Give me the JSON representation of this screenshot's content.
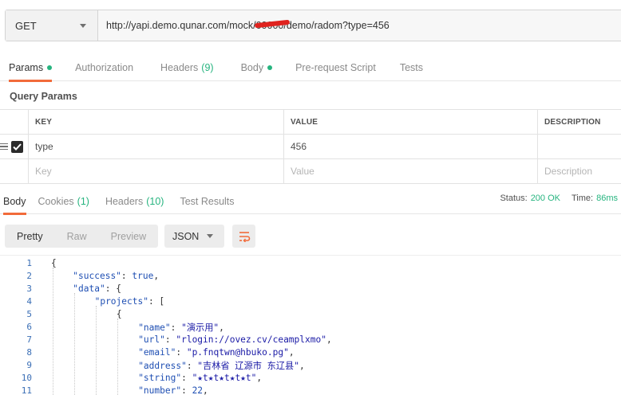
{
  "request": {
    "method": "GET",
    "url": "http://yapi.demo.qunar.com/mock/00000/demo/radom?type=456"
  },
  "request_tabs": [
    {
      "label": "Params",
      "active": true,
      "dot": true
    },
    {
      "label": "Authorization"
    },
    {
      "label": "Headers",
      "count": "(9)"
    },
    {
      "label": "Body",
      "dot": true
    },
    {
      "label": "Pre-request Script"
    },
    {
      "label": "Tests"
    }
  ],
  "query_params": {
    "title": "Query Params",
    "columns": [
      "KEY",
      "VALUE",
      "DESCRIPTION"
    ],
    "rows": [
      {
        "key": "type",
        "value": "456",
        "description": "",
        "checked": true
      }
    ],
    "placeholders": {
      "key": "Key",
      "value": "Value",
      "description": "Description"
    }
  },
  "response_tabs": [
    {
      "label": "Body",
      "active": true
    },
    {
      "label": "Cookies",
      "count": "(1)"
    },
    {
      "label": "Headers",
      "count": "(10)"
    },
    {
      "label": "Test Results"
    }
  ],
  "status": {
    "status_label": "Status:",
    "status_value": "200 OK",
    "time_label": "Time:",
    "time_value": "86ms"
  },
  "view_modes": [
    "Pretty",
    "Raw",
    "Preview"
  ],
  "format": "JSON",
  "code_lines": [
    {
      "n": "1",
      "indent": 0,
      "parts": [
        [
          "p",
          "{"
        ]
      ]
    },
    {
      "n": "2",
      "indent": 1,
      "parts": [
        [
          "k",
          "\"success\""
        ],
        [
          "p",
          ": "
        ],
        [
          "b",
          "true"
        ],
        [
          "p",
          ","
        ]
      ]
    },
    {
      "n": "3",
      "indent": 1,
      "parts": [
        [
          "k",
          "\"data\""
        ],
        [
          "p",
          ": {"
        ]
      ]
    },
    {
      "n": "4",
      "indent": 2,
      "parts": [
        [
          "k",
          "\"projects\""
        ],
        [
          "p",
          ": ["
        ]
      ]
    },
    {
      "n": "5",
      "indent": 3,
      "parts": [
        [
          "p",
          "{"
        ]
      ]
    },
    {
      "n": "6",
      "indent": 4,
      "parts": [
        [
          "k",
          "\"name\""
        ],
        [
          "p",
          ": "
        ],
        [
          "s",
          "\"演示用\""
        ],
        [
          "p",
          ","
        ]
      ]
    },
    {
      "n": "7",
      "indent": 4,
      "parts": [
        [
          "k",
          "\"url\""
        ],
        [
          "p",
          ": "
        ],
        [
          "s",
          "\"rlogin://ovez.cv/ceamplxmo\""
        ],
        [
          "p",
          ","
        ]
      ]
    },
    {
      "n": "8",
      "indent": 4,
      "parts": [
        [
          "k",
          "\"email\""
        ],
        [
          "p",
          ": "
        ],
        [
          "s",
          "\"p.fnqtwn@hbuko.pg\""
        ],
        [
          "p",
          ","
        ]
      ]
    },
    {
      "n": "9",
      "indent": 4,
      "parts": [
        [
          "k",
          "\"address\""
        ],
        [
          "p",
          ": "
        ],
        [
          "s",
          "\"吉林省 辽源市 东辽县\""
        ],
        [
          "p",
          ","
        ]
      ]
    },
    {
      "n": "10",
      "indent": 4,
      "parts": [
        [
          "k",
          "\"string\""
        ],
        [
          "p",
          ": "
        ],
        [
          "s",
          "\"★t★t★t★t★t\""
        ],
        [
          "p",
          ","
        ]
      ]
    },
    {
      "n": "11",
      "indent": 4,
      "parts": [
        [
          "k",
          "\"number\""
        ],
        [
          "p",
          ": "
        ],
        [
          "n",
          "22"
        ],
        [
          "p",
          ","
        ]
      ]
    }
  ]
}
